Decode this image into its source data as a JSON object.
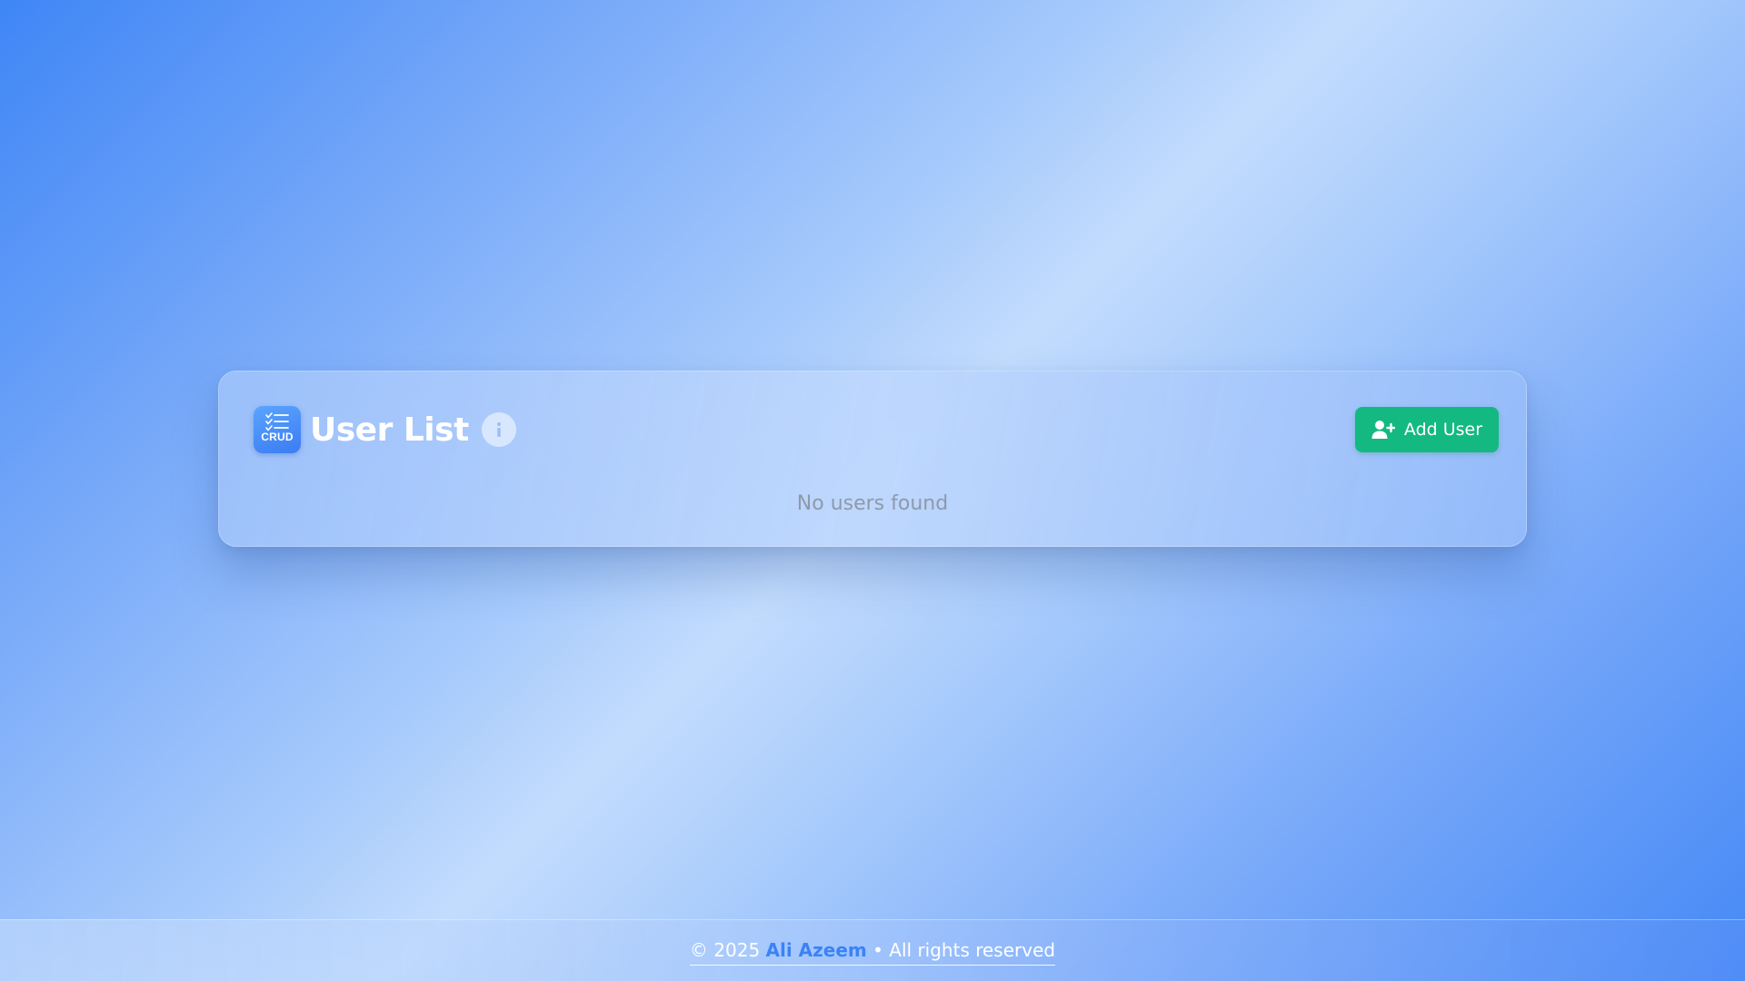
{
  "header": {
    "logo_text": "CRUD",
    "logo_icon": "checklist-icon",
    "title": "User List",
    "info_icon": "info-icon",
    "add_button_label": "Add User",
    "add_button_icon": "user-plus-icon"
  },
  "list": {
    "empty_message": "No users found"
  },
  "footer": {
    "copyright": "© 2025",
    "author": "Ali Azeem",
    "rights": "• All rights reserved"
  },
  "colors": {
    "accent": "#3b82f6",
    "success": "#13b981",
    "muted_text": "#8e9aaa"
  }
}
